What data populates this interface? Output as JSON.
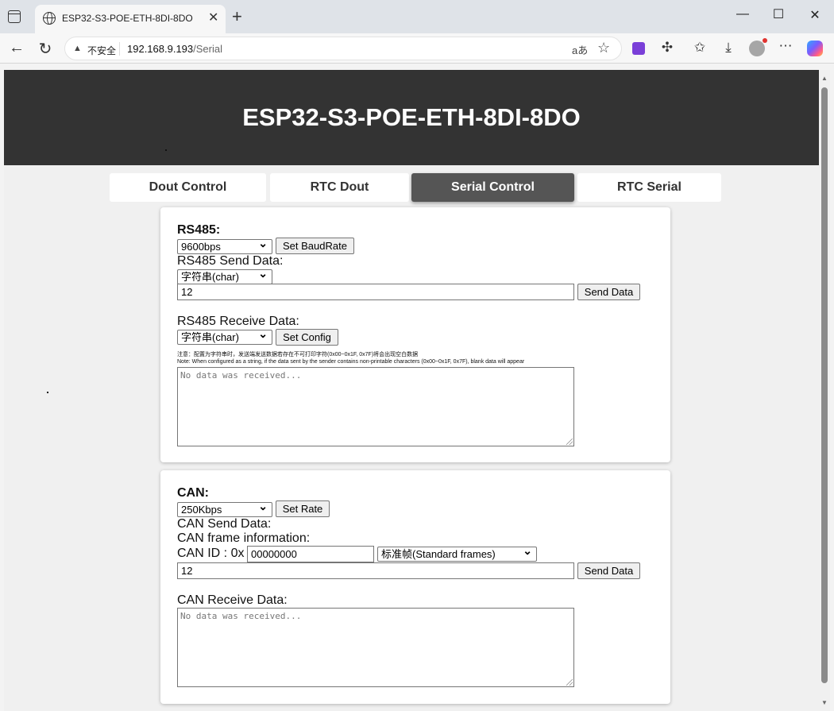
{
  "browser": {
    "tab_title": "ESP32-S3-POE-ETH-8DI-8DO",
    "insecure_label": "不安全",
    "url_host": "192.168.9.193",
    "url_path": "/Serial",
    "reader_label": "aあ"
  },
  "page": {
    "title": "ESP32-S3-POE-ETH-8DI-8DO",
    "tabs": [
      {
        "label": "Dout Control",
        "active": false
      },
      {
        "label": "RTC Dout",
        "active": false
      },
      {
        "label": "Serial Control",
        "active": true
      },
      {
        "label": "RTC Serial",
        "active": false
      }
    ]
  },
  "rs485": {
    "heading": "RS485:",
    "baud_value": "9600bps",
    "set_baud_label": "Set BaudRate",
    "send_label": "RS485 Send Data:",
    "send_format": "字符串(char)",
    "send_value": "12",
    "send_button": "Send Data",
    "receive_label": "RS485 Receive Data:",
    "receive_format": "字符串(char)",
    "set_config_label": "Set Config",
    "note_cn": "注意：配置为字符串时，发送端发送数据若存在不可打印字符(0x00~0x1F, 0x7F)将会出现空白数据",
    "note_en": "Note: When configured as a string, if the data sent by the sender contains non-printable characters (0x00~0x1F, 0x7F), blank data will appear",
    "receive_placeholder": "No data was received..."
  },
  "can": {
    "heading": "CAN:",
    "rate_value": "250Kbps",
    "set_rate_label": "Set Rate",
    "send_label": "CAN Send Data:",
    "frame_info_label": "CAN frame information:",
    "id_label": "CAN ID : 0x",
    "id_value": "00000000",
    "frame_type": "标准帧(Standard frames)",
    "send_value": "12",
    "send_button": "Send Data",
    "receive_label": "CAN Receive Data:",
    "receive_placeholder": "No data was received..."
  },
  "colors": {
    "header_bg": "#333333",
    "active_tab_bg": "#555555"
  }
}
